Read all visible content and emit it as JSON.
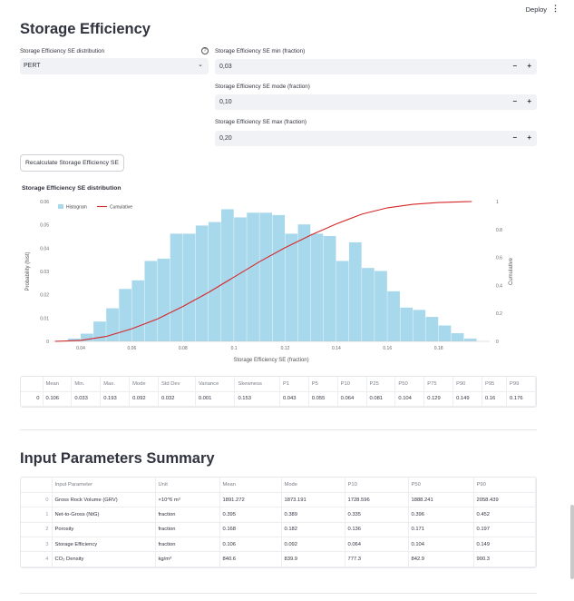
{
  "header": {
    "deploy_label": "Deploy",
    "menu_glyph": "⋮"
  },
  "title": "Storage Efficiency",
  "distribution": {
    "label": "Storage Efficiency SE distribution",
    "help_glyph": "?",
    "selected": "PERT",
    "chevron": "⌄"
  },
  "inputs": [
    {
      "label": "Storage Efficiency SE min (fraction)",
      "value": "0,03",
      "minus": "−",
      "plus": "+"
    },
    {
      "label": "Storage Efficiency SE mode (fraction)",
      "value": "0,10",
      "minus": "−",
      "plus": "+"
    },
    {
      "label": "Storage Efficiency SE max (fraction)",
      "value": "0,20",
      "minus": "−",
      "plus": "+"
    }
  ],
  "recalc_button": "Recalculate Storage Efficiency SE",
  "chart_data": {
    "type": "bar",
    "title": "Storage Efficiency SE distribution",
    "xlabel": "Storage Efficiency SE (fraction)",
    "ylabel": "Probability (hist)",
    "y2label": "Cumulative",
    "xlim": [
      0.029,
      0.2
    ],
    "ylim": [
      0,
      0.06
    ],
    "y2lim": [
      0,
      1
    ],
    "x_ticks": [
      "0.04",
      "0.06",
      "0.08",
      "0.1",
      "0.12",
      "0.14",
      "0.16",
      "0.18"
    ],
    "x_tick_values": [
      0.04,
      0.06,
      0.08,
      0.1,
      0.12,
      0.14,
      0.16,
      0.18
    ],
    "y_ticks": [
      "0",
      "0.01",
      "0.02",
      "0.03",
      "0.04",
      "0.05",
      "0.06"
    ],
    "y_tick_values": [
      0,
      0.01,
      0.02,
      0.03,
      0.04,
      0.05,
      0.06
    ],
    "y2_ticks": [
      "0",
      "0.2",
      "0.4",
      "0.6",
      "0.8",
      "1"
    ],
    "y2_tick_values": [
      0,
      0.2,
      0.4,
      0.6,
      0.8,
      1
    ],
    "grid": false,
    "legend_position": "top-left",
    "series": [
      {
        "name": "Histogram",
        "color": "#a8d8ec",
        "bin_width": 0.005,
        "bin_starts": [
          0.03,
          0.035,
          0.04,
          0.045,
          0.05,
          0.055,
          0.06,
          0.065,
          0.07,
          0.075,
          0.08,
          0.085,
          0.09,
          0.095,
          0.1,
          0.105,
          0.11,
          0.115,
          0.12,
          0.125,
          0.13,
          0.135,
          0.14,
          0.145,
          0.15,
          0.155,
          0.16,
          0.165,
          0.17,
          0.175,
          0.18,
          0.185,
          0.19
        ],
        "values": [
          0.0003,
          0.0012,
          0.0033,
          0.0085,
          0.0142,
          0.0225,
          0.0262,
          0.0345,
          0.0355,
          0.0462,
          0.0462,
          0.0497,
          0.0512,
          0.0567,
          0.0532,
          0.0552,
          0.0552,
          0.0542,
          0.0462,
          0.0502,
          0.0462,
          0.0452,
          0.0345,
          0.0425,
          0.0315,
          0.0302,
          0.0215,
          0.0145,
          0.0135,
          0.0105,
          0.0068,
          0.0035,
          0.0012
        ]
      },
      {
        "name": "Cumulative",
        "color": "#d62728",
        "axis": "right",
        "x": [
          0.03,
          0.04,
          0.05,
          0.06,
          0.07,
          0.08,
          0.09,
          0.1,
          0.11,
          0.12,
          0.13,
          0.14,
          0.15,
          0.16,
          0.17,
          0.18,
          0.19,
          0.193
        ],
        "values": [
          0,
          0.007,
          0.035,
          0.09,
          0.16,
          0.25,
          0.35,
          0.46,
          0.57,
          0.67,
          0.76,
          0.84,
          0.91,
          0.955,
          0.98,
          0.993,
          0.999,
          1
        ]
      }
    ]
  },
  "stats_table": {
    "columns": [
      "",
      "Mean",
      "Min.",
      "Max.",
      "Mode",
      "Std Dev",
      "Variance",
      "Skewness",
      "P1",
      "P5",
      "P10",
      "P25",
      "P50",
      "P75",
      "P90",
      "P95",
      "P99"
    ],
    "rows": [
      [
        "0",
        "0.106",
        "0.033",
        "0.193",
        "0.092",
        "0.032",
        "0.001",
        "0.153",
        "0.043",
        "0.055",
        "0.064",
        "0.081",
        "0.104",
        "0.129",
        "0.149",
        "0.16",
        "0.176"
      ]
    ]
  },
  "summary": {
    "title": "Input Parameters Summary",
    "columns": [
      "",
      "Input Parameter",
      "Unit",
      "Mean",
      "Mode",
      "P10",
      "P50",
      "P90"
    ],
    "rows": [
      [
        "0",
        "Gross Rock Volume (GRV)",
        "×10^6 m³",
        "1891.272",
        "1873.191",
        "1728.596",
        "1888.241",
        "2058.439"
      ],
      [
        "1",
        "Net-to-Gross (NtG)",
        "fraction",
        "0.395",
        "0.389",
        "0.335",
        "0.396",
        "0.452"
      ],
      [
        "2",
        "Porosity",
        "fraction",
        "0.168",
        "0.182",
        "0.136",
        "0.171",
        "0.197"
      ],
      [
        "3",
        "Storage Efficiency",
        "fraction",
        "0.106",
        "0.092",
        "0.064",
        "0.104",
        "0.149"
      ],
      [
        "4",
        "CO₂ Density",
        "kg/m³",
        "840.6",
        "839.9",
        "777.3",
        "842.9",
        "900.3"
      ]
    ]
  }
}
